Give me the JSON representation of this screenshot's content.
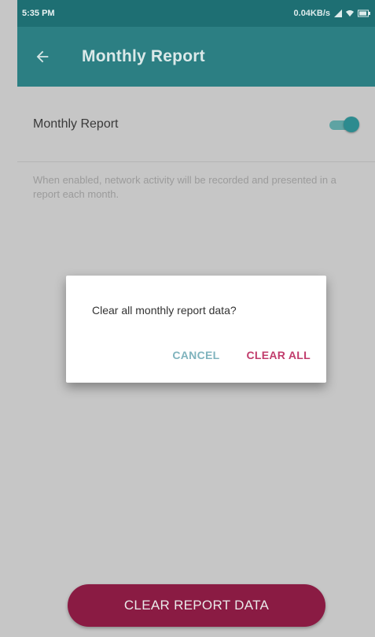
{
  "status_bar": {
    "time": "5:35 PM",
    "speed": "0.04KB/s",
    "icons": [
      "wifi-icon",
      "signal-icon",
      "battery-icon"
    ]
  },
  "toolbar": {
    "title": "Monthly Report",
    "back_icon": "arrow-left-icon"
  },
  "settings": {
    "monthly_report_label": "Monthly Report",
    "monthly_report_enabled": true,
    "description": "When enabled, network activity will be recorded and presented in a report each month."
  },
  "dialog": {
    "message": "Clear all monthly report data?",
    "cancel_label": "CANCEL",
    "confirm_label": "CLEAR ALL"
  },
  "bottom": {
    "clear_button_label": "CLEAR REPORT DATA"
  },
  "colors": {
    "toolbar": "#2c7f83",
    "status_bar": "#1e6f73",
    "accent": "#c13c6c",
    "clear_button": "#8a1b43"
  }
}
